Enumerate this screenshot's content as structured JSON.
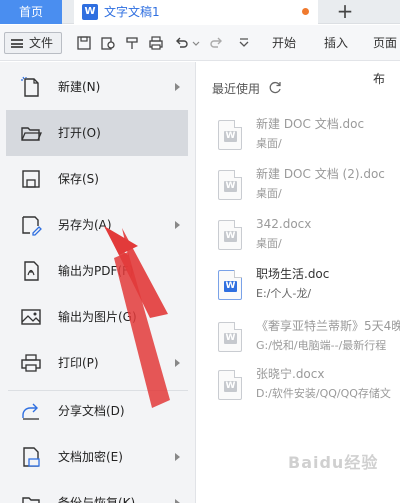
{
  "tabs": {
    "home": "首页",
    "doc_icon_letter": "W",
    "doc_title": "文字文稿1",
    "add": "+"
  },
  "toolbar": {
    "file_label": "文件",
    "ribbon_tabs": [
      "开始",
      "插入",
      "页面布"
    ],
    "icons": [
      "save-icon",
      "print-preview-icon",
      "format-painter-icon",
      "print-icon",
      "undo-icon",
      "redo-icon",
      "customize-icon"
    ]
  },
  "menu": {
    "items": [
      {
        "label": "新建(N)",
        "icon": "new-file-icon",
        "arrow": true
      },
      {
        "label": "打开(O)",
        "icon": "folder-open-icon",
        "arrow": false
      },
      {
        "label": "保存(S)",
        "icon": "save-icon",
        "arrow": false
      },
      {
        "label": "另存为(A)",
        "icon": "save-as-icon",
        "arrow": true
      },
      {
        "label": "输出为PDF(F)",
        "icon": "pdf-export-icon",
        "arrow": false
      },
      {
        "label": "输出为图片(G)",
        "icon": "image-export-icon",
        "arrow": false
      },
      {
        "label": "打印(P)",
        "icon": "printer-icon",
        "arrow": true
      },
      {
        "label": "分享文档(D)",
        "icon": "share-icon",
        "arrow": false
      },
      {
        "label": "文档加密(E)",
        "icon": "encrypt-icon",
        "arrow": true
      },
      {
        "label": "备份与恢复(K)",
        "icon": "backup-icon",
        "arrow": true
      }
    ]
  },
  "recent": {
    "title": "最近使用",
    "files": [
      {
        "name": "新建 DOC 文档.doc",
        "path": "桌面/",
        "type": "grey"
      },
      {
        "name": "新建 DOC 文档 (2).doc",
        "path": "桌面/",
        "type": "grey"
      },
      {
        "name": "342.docx",
        "path": "桌面/",
        "type": "grey"
      },
      {
        "name": "职场生活.doc",
        "path": "E:/个人-龙/",
        "type": "word"
      },
      {
        "name": "《奢享亚特兰蒂斯》5天4晚",
        "path": "G:/悦和/电脑端--/最新行程",
        "type": "grey"
      },
      {
        "name": "张晓宁.docx",
        "path": "D:/软件安装/QQ/QQ存储文",
        "type": "grey"
      }
    ]
  },
  "watermark": "Baidu经验",
  "colors": {
    "accent": "#4a8ef0",
    "word_blue": "#2f6fe0",
    "annotation_red": "#e23a3a",
    "tab_dot": "#f07a2e"
  }
}
